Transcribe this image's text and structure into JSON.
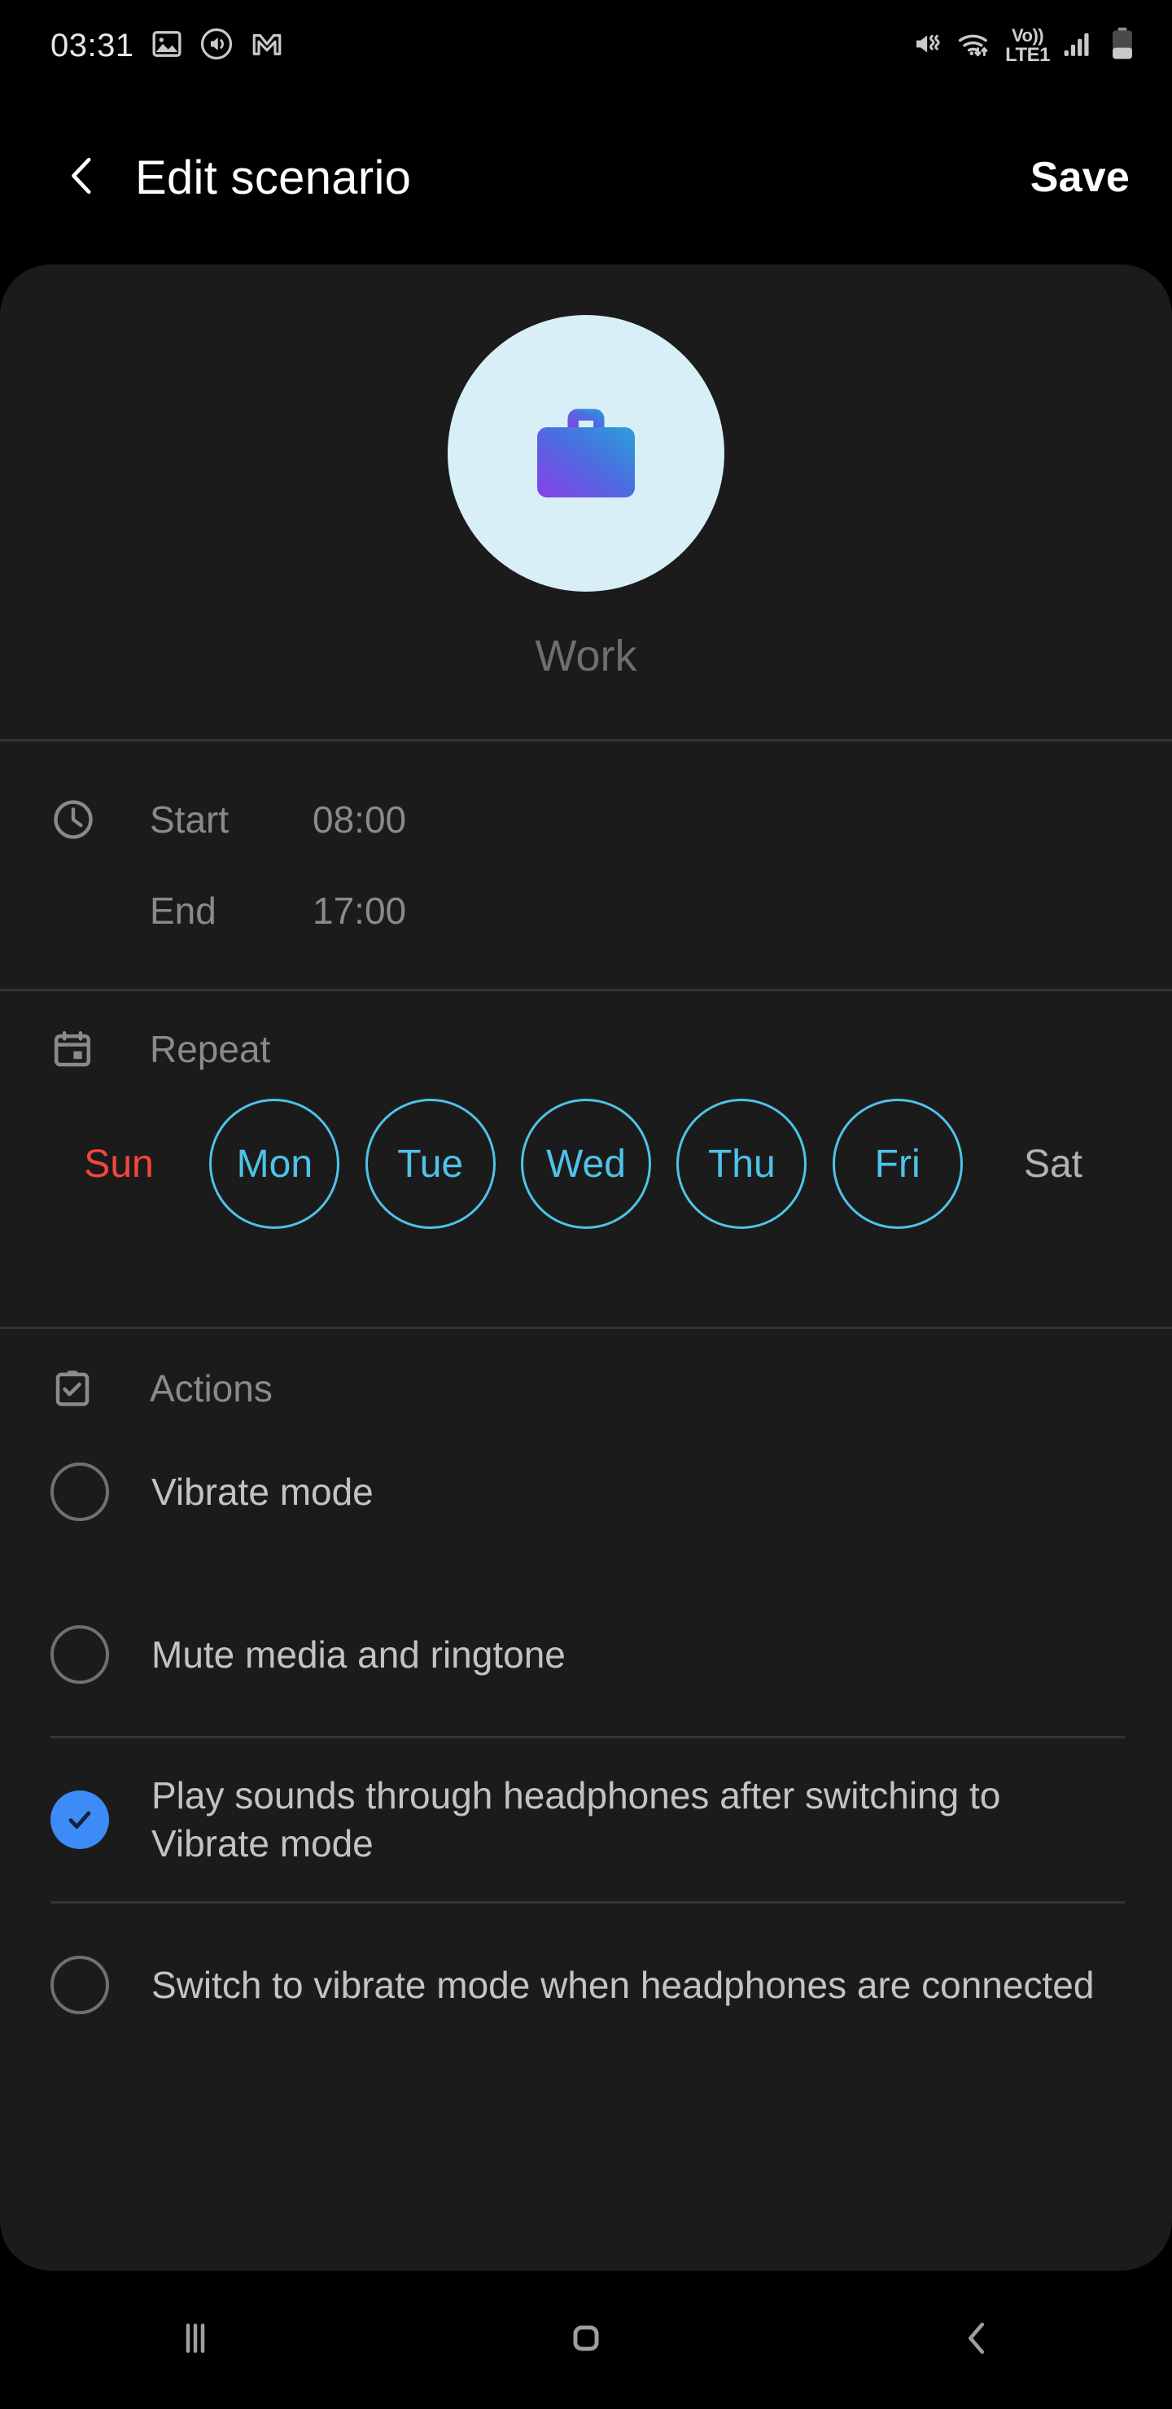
{
  "status_bar": {
    "time": "03:31",
    "left_icons": [
      "image-icon",
      "sound-icon",
      "gmail-icon"
    ],
    "right_icons": [
      "mute-vibrate-icon",
      "wifi-icon",
      "volte-icon",
      "signal-icon",
      "battery-icon"
    ],
    "volte_top": "Vo))",
    "volte_bottom": "LTE1"
  },
  "app_bar": {
    "back_icon": "chevron-left-icon",
    "title": "Edit scenario",
    "save_label": "Save"
  },
  "hero": {
    "icon": "briefcase-icon",
    "name": "Work",
    "circle_color": "#d8eff7",
    "gradient_from": "#8a3ee8",
    "gradient_to": "#2b9fd8"
  },
  "time_section": {
    "icon": "clock-icon",
    "start_label": "Start",
    "start_value": "08:00",
    "end_label": "End",
    "end_value": "17:00"
  },
  "repeat_section": {
    "icon": "calendar-icon",
    "title": "Repeat",
    "selected_color": "#4fc3e8",
    "sunday_color": "#f4473d",
    "saturday_color": "#b3b3b3",
    "days": [
      {
        "label": "Sun",
        "selected": false,
        "kind": "sun"
      },
      {
        "label": "Mon",
        "selected": true,
        "kind": "weekday"
      },
      {
        "label": "Tue",
        "selected": true,
        "kind": "weekday"
      },
      {
        "label": "Wed",
        "selected": true,
        "kind": "weekday"
      },
      {
        "label": "Thu",
        "selected": true,
        "kind": "weekday"
      },
      {
        "label": "Fri",
        "selected": true,
        "kind": "weekday"
      },
      {
        "label": "Sat",
        "selected": false,
        "kind": "sat"
      }
    ]
  },
  "actions_section": {
    "icon": "clipboard-check-icon",
    "title": "Actions",
    "checked_color": "#3d8bf6",
    "items": [
      {
        "label": "Vibrate mode",
        "checked": false
      },
      {
        "label": "Mute media and ringtone",
        "checked": false
      },
      {
        "label": "Play sounds through headphones after switching to Vibrate mode",
        "checked": true
      },
      {
        "label": "Switch to vibrate mode when headphones are connected",
        "checked": false
      }
    ]
  },
  "nav_bar": {
    "recents_icon": "recents-icon",
    "home_icon": "home-icon",
    "back_icon": "back-icon"
  }
}
